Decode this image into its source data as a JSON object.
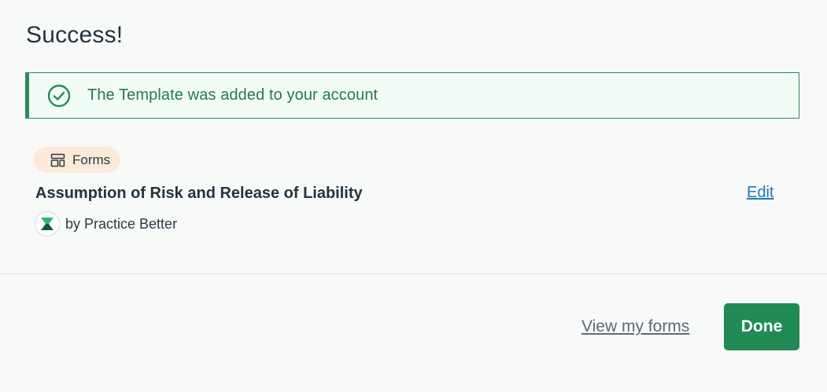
{
  "dialog": {
    "title": "Success!",
    "alert": {
      "message": "The Template was added to your account",
      "icon": "check-circle-icon",
      "color": "#218a55"
    },
    "template": {
      "category_label": "Forms",
      "category_icon": "layout-icon",
      "title": "Assumption of Risk and Release of Liability",
      "edit_label": "Edit",
      "author": "by Practice Better",
      "author_icon": "practice-better-logo"
    },
    "footer": {
      "view_forms_label": "View my forms",
      "done_label": "Done"
    }
  },
  "colors": {
    "accent": "#218a55",
    "link": "#1a7bb5",
    "pill_bg": "#fde9d8",
    "alert_bg": "#f2fcf7"
  }
}
